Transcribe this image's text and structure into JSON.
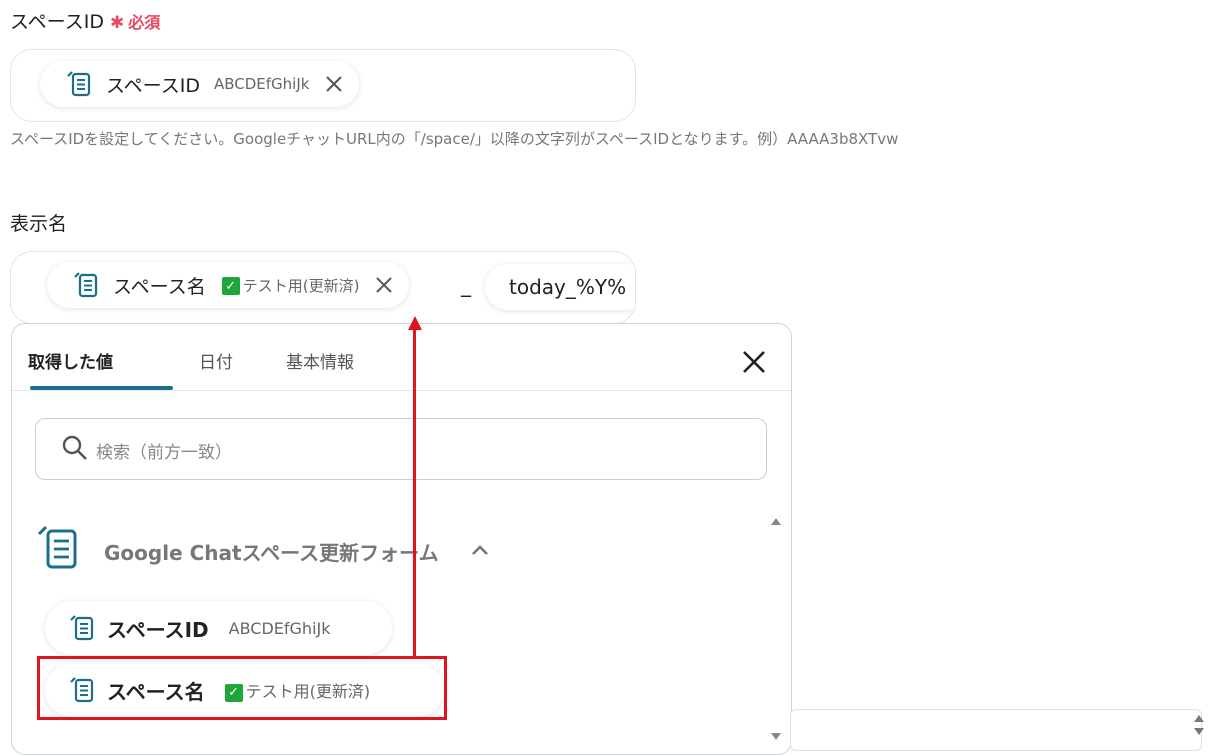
{
  "space_id_field": {
    "label": "スペースID",
    "required_star": "✱",
    "required_text": "必須",
    "chip": {
      "name": "スペースID",
      "value": "ABCDEfGhiJk"
    },
    "help": "スペースIDを設定してください。GoogleチャットURL内の「/space/」以降の文字列がスペースIDとなります。例）AAAA3b8XTvw"
  },
  "display_name_field": {
    "label": "表示名",
    "chip": {
      "name": "スペース名",
      "value": "テスト用(更新済)"
    },
    "separator": "_",
    "date_chip": "today_%Y%"
  },
  "picker": {
    "tabs": [
      "取得した値",
      "日付",
      "基本情報"
    ],
    "active_tab": 0,
    "search_placeholder": "検索（前方一致）",
    "group_title": "Google Chatスペース更新フォーム",
    "items": [
      {
        "name": "スペースID",
        "value": "ABCDEfGhiJk"
      },
      {
        "name": "スペース名",
        "value": "テスト用(更新済)"
      }
    ]
  },
  "colors": {
    "accent": "#1b6e8c",
    "required": "#e8475f",
    "highlight": "#e0141e",
    "check": "#1fa63a"
  }
}
